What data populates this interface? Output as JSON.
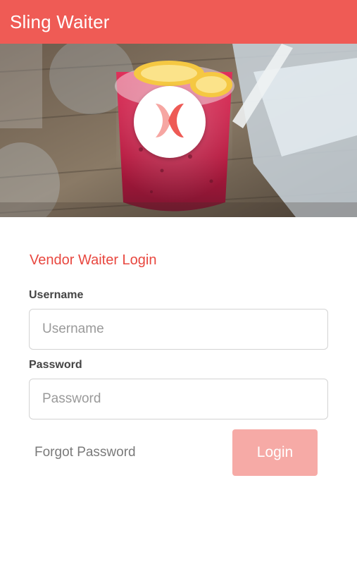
{
  "app": {
    "title": "Sling Waiter"
  },
  "form": {
    "title": "Vendor Waiter Login",
    "username_label": "Username",
    "username_placeholder": "Username",
    "username_value": "",
    "password_label": "Password",
    "password_placeholder": "Password",
    "password_value": "",
    "forgot_password": "Forgot Password",
    "login_button": "Login"
  },
  "colors": {
    "app_bar": "#ef5b55",
    "accent_text": "#e8473f",
    "login_button": "#f6aaa6"
  },
  "icons": {
    "logo": "sling-x-logo-icon"
  }
}
